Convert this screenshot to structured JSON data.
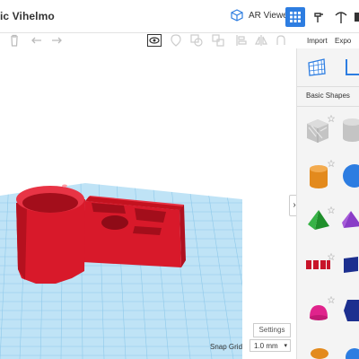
{
  "header": {
    "title": "ic Vihelmo",
    "ar_viewer_label": "AR Viewer"
  },
  "toolbar": {
    "import_label": "Import",
    "export_label": "Expo"
  },
  "panel": {
    "section_label": "Basic Shapes"
  },
  "footer": {
    "settings_label": "Settings",
    "snap_grid_label": "Snap Grid",
    "snap_grid_value": "1.0 mm"
  },
  "colors": {
    "accent": "#2d7de1",
    "workplane": "#bfe3f6",
    "grid_line": "#8fc9ea",
    "model_red": "#d8192a"
  }
}
